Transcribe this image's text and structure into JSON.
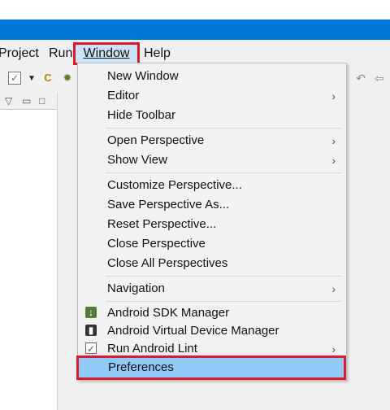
{
  "menubar": {
    "project": "Project",
    "run": "Run",
    "window": "Window",
    "help": "Help"
  },
  "toolbar": {
    "icons": [
      "check-icon",
      "dropdown-caret-icon",
      "new-class-icon",
      "debug-bug-icon",
      "back-arrow-icon",
      "back-alt-arrow-icon"
    ]
  },
  "window_menu": {
    "items": [
      {
        "label": "New Window",
        "has_submenu": false
      },
      {
        "label": "Editor",
        "has_submenu": true
      },
      {
        "label": "Hide Toolbar",
        "has_submenu": false
      },
      {
        "label": "Open Perspective",
        "has_submenu": true
      },
      {
        "label": "Show View",
        "has_submenu": true
      },
      {
        "label": "Customize Perspective...",
        "has_submenu": false
      },
      {
        "label": "Save Perspective As...",
        "has_submenu": false
      },
      {
        "label": "Reset Perspective...",
        "has_submenu": false
      },
      {
        "label": "Close Perspective",
        "has_submenu": false
      },
      {
        "label": "Close All Perspectives",
        "has_submenu": false
      },
      {
        "label": "Navigation",
        "has_submenu": true
      },
      {
        "label": "Android SDK Manager",
        "has_submenu": false,
        "icon": "android-sdk-manager-icon"
      },
      {
        "label": "Android Virtual Device Manager",
        "has_submenu": false,
        "icon": "android-virtual-device-icon"
      },
      {
        "label": "Run Android Lint",
        "has_submenu": true,
        "icon": "lint-check-icon"
      },
      {
        "label": "Preferences",
        "has_submenu": false,
        "selected": true
      }
    ],
    "submenu_arrow": "›"
  },
  "colors": {
    "title_band": "#0078d7",
    "highlight_border": "#e0192c",
    "selection_fill": "#91c9f7",
    "menu_bg": "#f2f2f2"
  }
}
